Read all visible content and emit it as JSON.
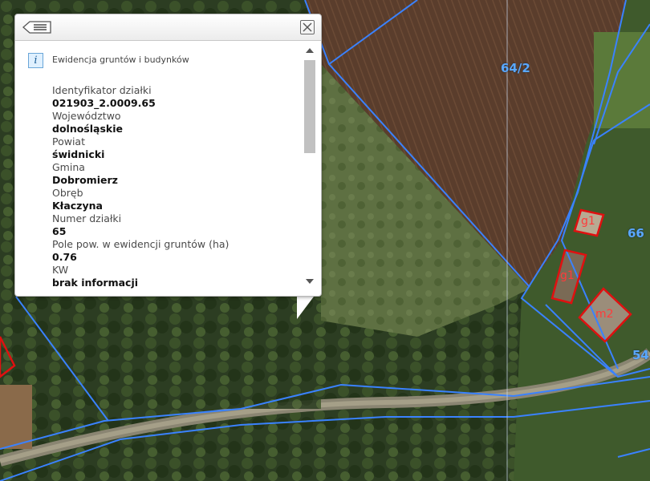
{
  "map": {
    "parcel_labels": [
      "64/2",
      "66",
      "54"
    ],
    "building_labels": [
      "g1",
      "g1",
      "m2"
    ],
    "parcel_line_color": "#3a82ff",
    "building_outline_color": "#e01010"
  },
  "popup": {
    "back_icon": "list-back-icon",
    "close_icon": "close-icon",
    "info_icon": "info-icon",
    "info_glyph": "i",
    "title": "Ewidencja gruntów i budynków",
    "fields": [
      {
        "label": "Identyfikator działki",
        "value": "021903_2.0009.65"
      },
      {
        "label": "Województwo",
        "value": "dolnośląskie"
      },
      {
        "label": "Powiat",
        "value": "świdnicki"
      },
      {
        "label": "Gmina",
        "value": "Dobromierz"
      },
      {
        "label": "Obręb",
        "value": "Kłaczyna"
      },
      {
        "label": "Numer działki",
        "value": "65"
      },
      {
        "label": "Pole pow. w ewidencji gruntów (ha)",
        "value": "0.76"
      },
      {
        "label": "KW",
        "value": "brak informacji"
      }
    ]
  }
}
